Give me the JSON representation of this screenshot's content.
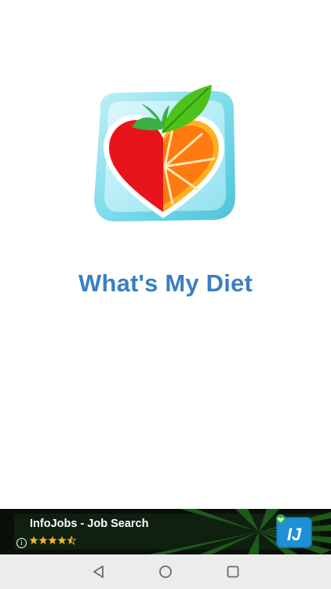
{
  "app": {
    "title": "What's My Diet",
    "icon": "heart-fruit-logo-icon"
  },
  "ad": {
    "title": "InfoJobs - Job Search",
    "info_glyph": "i",
    "rating": 4.5,
    "rating_max": 5,
    "app_icon": "infojobs-logo-icon",
    "app_icon_text": "IJ",
    "badge_icon": "heart-badge-icon"
  },
  "navigation": {
    "back": "back-triangle-icon",
    "home": "home-circle-icon",
    "recents": "recents-square-icon"
  },
  "colors": {
    "title": "#3a7fc2",
    "nav_bar": "#ececec",
    "ad_background": "#0a0f0a"
  }
}
